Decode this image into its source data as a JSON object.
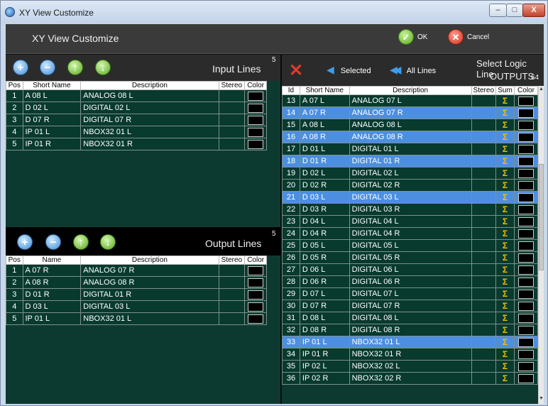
{
  "window": {
    "title": "XY View Customize",
    "min": "–",
    "max": "□",
    "close": "X"
  },
  "header": {
    "title": "XY View Customize",
    "ok_label": "OK",
    "cancel_label": "Cancel"
  },
  "input_panel": {
    "title": "Input Lines",
    "count": "5",
    "columns": [
      "Pos",
      "Short Name",
      "Description",
      "Stereo",
      "Color"
    ],
    "rows": [
      {
        "pos": "1",
        "short": "A 08 L",
        "desc": "ANALOG 08 L"
      },
      {
        "pos": "2",
        "short": "D 02 L",
        "desc": "DIGITAL 02 L"
      },
      {
        "pos": "3",
        "short": "D 07 R",
        "desc": "DIGITAL 07 R"
      },
      {
        "pos": "4",
        "short": "IP 01 L",
        "desc": "NBOX32 01 L"
      },
      {
        "pos": "5",
        "short": "IP 01 R",
        "desc": "NBOX32 01 R"
      }
    ]
  },
  "output_panel": {
    "title": "Output Lines",
    "count": "5",
    "columns": [
      "Pos",
      "Name",
      "Description",
      "Stereo",
      "Color"
    ],
    "rows": [
      {
        "pos": "1",
        "short": "A 07 R",
        "desc": "ANALOG 07 R"
      },
      {
        "pos": "2",
        "short": "A 08 R",
        "desc": "ANALOG 08 R"
      },
      {
        "pos": "3",
        "short": "D 01 R",
        "desc": "DIGITAL 01 R"
      },
      {
        "pos": "4",
        "short": "D 03 L",
        "desc": "DIGITAL 03 L"
      },
      {
        "pos": "5",
        "short": "IP 01 L",
        "desc": "NBOX32 01 L"
      }
    ]
  },
  "logic_panel": {
    "selected_label": "Selected",
    "all_lines_label": "All Lines",
    "title": "Select Logic Line",
    "subtitle": "OUTPUTS",
    "count": "64",
    "sum_symbol": "Σ",
    "columns": [
      "Id",
      "Short Name",
      "Description",
      "Stereo",
      "Sum",
      "Color"
    ],
    "rows": [
      {
        "id": "13",
        "short": "A 07 L",
        "desc": "ANALOG 07 L",
        "selected": false
      },
      {
        "id": "14",
        "short": "A 07 R",
        "desc": "ANALOG 07 R",
        "selected": true
      },
      {
        "id": "15",
        "short": "A 08 L",
        "desc": "ANALOG 08 L",
        "selected": false
      },
      {
        "id": "16",
        "short": "A 08 R",
        "desc": "ANALOG 08 R",
        "selected": true
      },
      {
        "id": "17",
        "short": "D 01 L",
        "desc": "DIGITAL 01 L",
        "selected": false
      },
      {
        "id": "18",
        "short": "D 01 R",
        "desc": "DIGITAL 01 R",
        "selected": true
      },
      {
        "id": "19",
        "short": "D 02 L",
        "desc": "DIGITAL 02 L",
        "selected": false
      },
      {
        "id": "20",
        "short": "D 02 R",
        "desc": "DIGITAL 02 R",
        "selected": false
      },
      {
        "id": "21",
        "short": "D 03 L",
        "desc": "DIGITAL 03 L",
        "selected": true
      },
      {
        "id": "22",
        "short": "D 03 R",
        "desc": "DIGITAL 03 R",
        "selected": false
      },
      {
        "id": "23",
        "short": "D 04 L",
        "desc": "DIGITAL 04 L",
        "selected": false
      },
      {
        "id": "24",
        "short": "D 04 R",
        "desc": "DIGITAL 04 R",
        "selected": false
      },
      {
        "id": "25",
        "short": "D 05 L",
        "desc": "DIGITAL 05 L",
        "selected": false
      },
      {
        "id": "26",
        "short": "D 05 R",
        "desc": "DIGITAL 05 R",
        "selected": false
      },
      {
        "id": "27",
        "short": "D 06 L",
        "desc": "DIGITAL 06 L",
        "selected": false
      },
      {
        "id": "28",
        "short": "D 06 R",
        "desc": "DIGITAL 06 R",
        "selected": false
      },
      {
        "id": "29",
        "short": "D 07 L",
        "desc": "DIGITAL 07 L",
        "selected": false
      },
      {
        "id": "30",
        "short": "D 07 R",
        "desc": "DIGITAL 07 R",
        "selected": false
      },
      {
        "id": "31",
        "short": "D 08 L",
        "desc": "DIGITAL 08 L",
        "selected": false
      },
      {
        "id": "32",
        "short": "D 08 R",
        "desc": "DIGITAL 08 R",
        "selected": false
      },
      {
        "id": "33",
        "short": "IP 01 L",
        "desc": "NBOX32 01 L",
        "selected": true
      },
      {
        "id": "34",
        "short": "IP 01 R",
        "desc": "NBOX32 01 R",
        "selected": false
      },
      {
        "id": "35",
        "short": "IP 02 L",
        "desc": "NBOX32 02 L",
        "selected": false
      },
      {
        "id": "36",
        "short": "IP 02 R",
        "desc": "NBOX32 02 R",
        "selected": false
      }
    ]
  },
  "colors": {
    "row_bg": "#083a2e",
    "selected_bg": "#4c8fe0",
    "sum": "#f3c000"
  }
}
